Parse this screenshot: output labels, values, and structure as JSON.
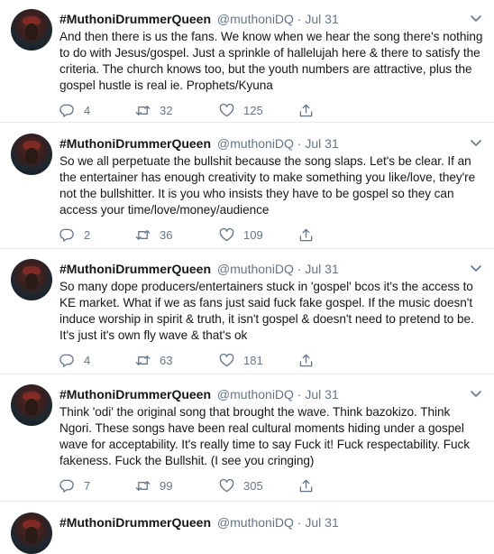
{
  "tweets": [
    {
      "name": "#MuthoniDrummerQueen",
      "handle": "@muthoniDQ",
      "dot": "·",
      "date": "Jul 31",
      "text": "And then there is us the fans. We know when we hear the song there's nothing to do with Jesus/gospel. Just a sprinkle of hallelujah here & there to satisfy the criteria. The church knows too, but the youth numbers are attractive, plus the gospel hustle is real ie. Prophets/Kyuna",
      "replies": "4",
      "retweets": "32",
      "likes": "125"
    },
    {
      "name": "#MuthoniDrummerQueen",
      "handle": "@muthoniDQ",
      "dot": "·",
      "date": "Jul 31",
      "text": "So we all perpetuate the bullshit because the song slaps. Let's be clear. If an the entertainer has enough creativity to make something you like/love, they're not the bullshitter. It is you who insists they have to be gospel so they can access your time/love/money/audience",
      "replies": "2",
      "retweets": "36",
      "likes": "109"
    },
    {
      "name": "#MuthoniDrummerQueen",
      "handle": "@muthoniDQ",
      "dot": "·",
      "date": "Jul 31",
      "text": "So many dope producers/entertainers stuck in 'gospel' bcos it's the access to KE market. What if we as fans just said fuck fake gospel. If the music doesn't induce worship in spirit & truth, it isn't gospel & doesn't need to pretend to be. It's just it's own fly wave & that's ok",
      "replies": "4",
      "retweets": "63",
      "likes": "181"
    },
    {
      "name": "#MuthoniDrummerQueen",
      "handle": "@muthoniDQ",
      "dot": "·",
      "date": "Jul 31",
      "text": "Think 'odi' the original song that brought the wave. Think bazokizo. Think Ngori. These songs have been real cultural moments hiding under a gospel wave for acceptability. It's really time to say Fuck it! Fuck respectability. Fuck fakeness. Fuck the Bullshit. (I see you cringing)",
      "replies": "7",
      "retweets": "99",
      "likes": "305"
    },
    {
      "name": "#MuthoniDrummerQueen",
      "handle": "@muthoniDQ",
      "dot": "·",
      "date": "Jul 31",
      "text": "",
      "replies": "",
      "retweets": "",
      "likes": ""
    }
  ],
  "icons": {
    "reply": "reply-icon",
    "retweet": "retweet-icon",
    "like": "heart-icon",
    "share": "share-icon",
    "menu": "chevron-down-icon"
  },
  "colors": {
    "text": "#14171a",
    "secondary": "#657786",
    "divider": "#e6ecf0"
  }
}
